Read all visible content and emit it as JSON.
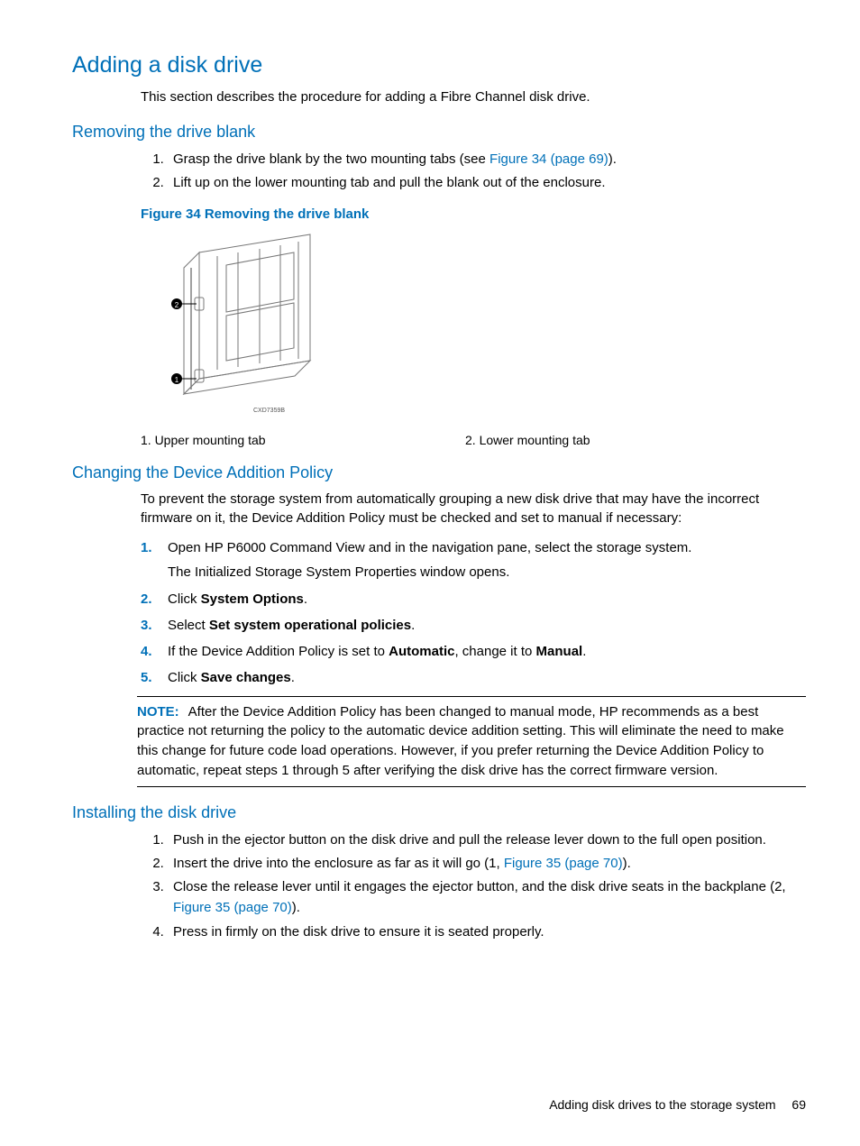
{
  "h1": "Adding a disk drive",
  "intro": "This section describes the procedure for adding a Fibre Channel disk drive.",
  "sec1": {
    "title": "Removing the drive blank",
    "steps": {
      "s1a": "Grasp the drive blank by the two mounting tabs (see ",
      "s1link": "Figure 34 (page 69)",
      "s1b": ").",
      "s2": "Lift up on the lower mounting tab and pull the blank out of the enclosure."
    },
    "figcap": "Figure 34 Removing the drive blank",
    "figid": "CXD7359B",
    "callout1": "1. Upper mounting tab",
    "callout2": "2. Lower mounting tab"
  },
  "sec2": {
    "title": "Changing the Device Addition Policy",
    "para": "To prevent the storage system from automatically grouping a new disk drive that may have the incorrect firmware on it, the Device Addition Policy must be checked and set to manual if necessary:",
    "step1a": "Open HP P6000 Command View and in the navigation pane, select the storage system.",
    "step1b": "The Initialized Storage System Properties window opens.",
    "step2a": "Click ",
    "step2b": "System Options",
    "step2c": ".",
    "step3a": "Select ",
    "step3b": "Set system operational policies",
    "step3c": ".",
    "step4a": "If the Device Addition Policy is set to ",
    "step4b": "Automatic",
    "step4c": ", change it to ",
    "step4d": "Manual",
    "step4e": ".",
    "step5a": "Click ",
    "step5b": "Save changes",
    "step5c": ".",
    "note_label": "NOTE:",
    "note_body": "After the Device Addition Policy has been changed to manual mode, HP recommends as a best practice not returning the policy to the automatic device addition setting. This will eliminate the need to make this change for future code load operations. However, if you prefer returning the Device Addition Policy to automatic, repeat steps 1 through 5 after verifying the disk drive has the correct firmware version."
  },
  "sec3": {
    "title": "Installing the disk drive",
    "s1": "Push in the ejector button on the disk drive and pull the release lever down to the full open position.",
    "s2a": "Insert the drive into the enclosure as far as it will go (1, ",
    "s2link": "Figure 35 (page 70)",
    "s2b": ").",
    "s3a": "Close the release lever until it engages the ejector button, and the disk drive seats in the backplane (2, ",
    "s3link": "Figure 35 (page 70)",
    "s3b": ").",
    "s4": "Press in firmly on the disk drive to ensure it is seated properly."
  },
  "footer": {
    "text": "Adding disk drives to the storage system",
    "page": "69"
  }
}
